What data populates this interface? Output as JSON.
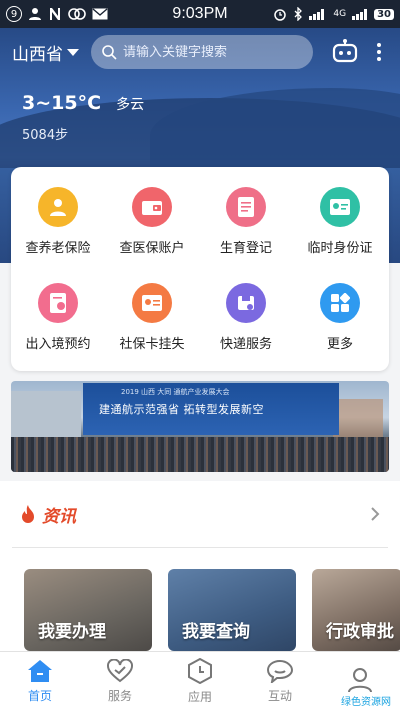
{
  "status_bar": {
    "notification_count": "9",
    "time": "9:03PM",
    "network": "4G",
    "battery": "30"
  },
  "header": {
    "province": "山西省",
    "search_placeholder": "请输入关键字搜索"
  },
  "weather": {
    "temperature": "3~15°C",
    "condition": "多云",
    "steps": "5084步"
  },
  "services": [
    {
      "label": "查养老保险",
      "icon": "pension-icon",
      "color": "#f6b52a"
    },
    {
      "label": "查医保账户",
      "icon": "medical-wallet-icon",
      "color": "#f0656b"
    },
    {
      "label": "生育登记",
      "icon": "document-icon",
      "color": "#ef6f88"
    },
    {
      "label": "临时身份证",
      "icon": "id-card-icon",
      "color": "#2fc0a5"
    },
    {
      "label": "出入境预约",
      "icon": "passport-icon",
      "color": "#f26d8e"
    },
    {
      "label": "社保卡挂失",
      "icon": "card-report-icon",
      "color": "#f47a43"
    },
    {
      "label": "快递服务",
      "icon": "delivery-icon",
      "color": "#7b69e0"
    },
    {
      "label": "更多",
      "icon": "grid-more-icon",
      "color": "#2f9af0"
    }
  ],
  "banner": {
    "headline": "建通航示范强省   拓转型发展新空",
    "subline": "2019 山西 大同 通航产业发展大会"
  },
  "news": {
    "title": "资讯",
    "tiles": [
      {
        "label": "我要办理"
      },
      {
        "label": "我要查询"
      },
      {
        "label": "行政审批"
      }
    ]
  },
  "nav": [
    {
      "label": "首页",
      "icon": "home-icon",
      "active": true
    },
    {
      "label": "服务",
      "icon": "heart-hand-icon",
      "active": false
    },
    {
      "label": "应用",
      "icon": "hexagon-clock-icon",
      "active": false
    },
    {
      "label": "互动",
      "icon": "chat-bubble-icon",
      "active": false
    },
    {
      "label": "",
      "icon": "user-icon",
      "active": false
    }
  ],
  "watermark": "绿色资源网"
}
